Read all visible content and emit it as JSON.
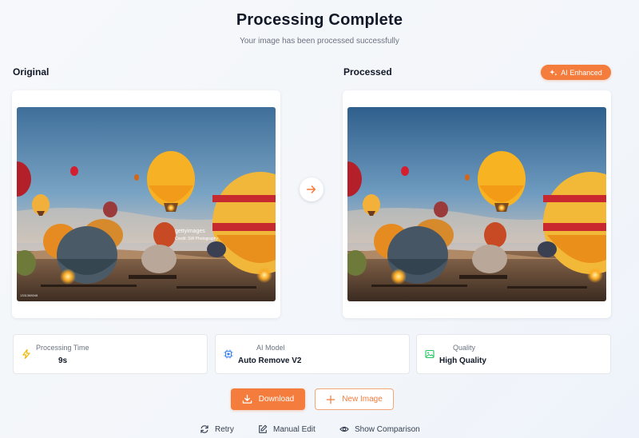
{
  "header": {
    "title": "Processing Complete",
    "subtitle": "Your image has been processed successfully"
  },
  "original": {
    "label": "Original",
    "watermark_line1": "gettyimages",
    "watermark_line2": "Credit: SW Photography",
    "stock_id": "1331368048"
  },
  "processed": {
    "label": "Processed",
    "badge": "AI Enhanced"
  },
  "stats": [
    {
      "label": "Processing Time",
      "value": "9s",
      "icon": "lightning-icon",
      "color": "#f2b705"
    },
    {
      "label": "AI Model",
      "value": "Auto Remove V2",
      "icon": "chip-icon",
      "color": "#3b82f6"
    },
    {
      "label": "Quality",
      "value": "High Quality",
      "icon": "image-icon",
      "color": "#22c55e"
    }
  ],
  "actions": {
    "download": "Download",
    "new_image": "New Image"
  },
  "links": {
    "retry": "Retry",
    "manual_edit": "Manual Edit",
    "show_comparison": "Show Comparison"
  },
  "colors": {
    "accent": "#f47c3c"
  }
}
